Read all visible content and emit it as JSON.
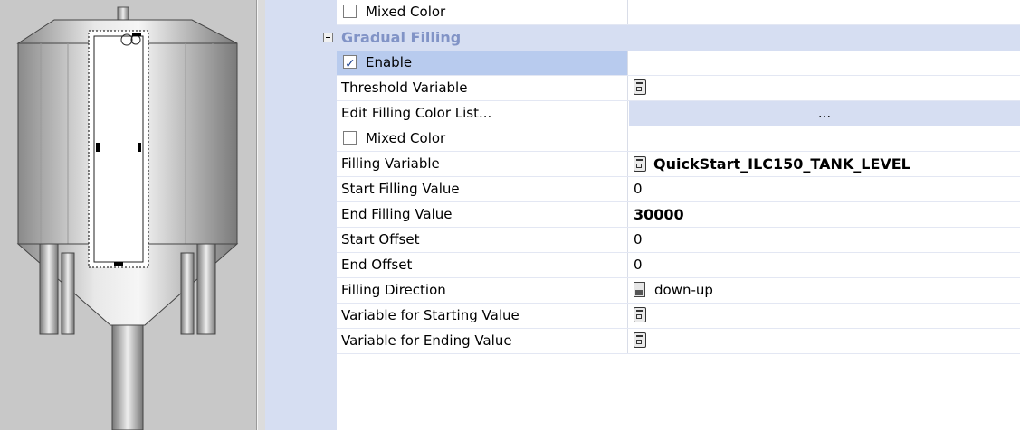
{
  "canvas": {
    "object": "tank"
  },
  "category": {
    "label": "Gradual Filling",
    "collapsed_icon": "minus-box-icon"
  },
  "rows_top": [
    {
      "name": "Mixed Color",
      "checkbox": true,
      "checked": false,
      "value": ""
    }
  ],
  "rows": [
    {
      "name": "Enable",
      "checkbox": true,
      "checked": true,
      "value": "",
      "selected": true
    },
    {
      "name": "Threshold Variable",
      "icon": "tag-icon",
      "value": ""
    },
    {
      "name": "Edit Filling Color List...",
      "value": "...",
      "button": true
    },
    {
      "name": "Mixed Color",
      "checkbox": true,
      "checked": false,
      "value": ""
    },
    {
      "name": "Filling Variable",
      "icon": "tag-icon",
      "value": "QuickStart_ILC150_TANK_LEVEL",
      "bold": true
    },
    {
      "name": "Start Filling Value",
      "value": "0"
    },
    {
      "name": "End Filling Value",
      "value": "30000",
      "bold": true
    },
    {
      "name": "Start Offset",
      "value": "0"
    },
    {
      "name": "End Offset",
      "value": "0"
    },
    {
      "name": "Filling Direction",
      "icon": "direction-icon",
      "value": "down-up"
    },
    {
      "name": "Variable for Starting Value",
      "icon": "tag-icon",
      "value": ""
    },
    {
      "name": "Variable for Ending Value",
      "icon": "tag-icon",
      "value": ""
    }
  ]
}
